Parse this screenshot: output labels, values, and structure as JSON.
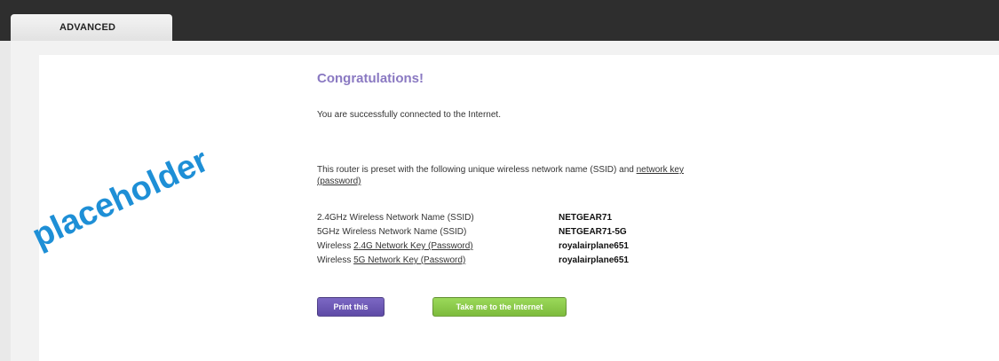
{
  "tabs": {
    "advanced_label": "ADVANCED"
  },
  "main": {
    "title": "Congratulations!",
    "success_message": "You are successfully connected to the Internet.",
    "preset_line1_before": "This router is preset with the following unique wireless network name (SSID) and ",
    "preset_link_part1": "network key",
    "preset_link_part2": "(password)",
    "network_info": [
      {
        "label_before": "2.4GHz Wireless Network Name (SSID)",
        "link": "",
        "label_after": "",
        "value": "NETGEAR71"
      },
      {
        "label_before": "5GHz Wireless Network Name (SSID)",
        "link": "",
        "label_after": "",
        "value": "NETGEAR71-5G"
      },
      {
        "label_before": "Wireless ",
        "link": "2.4G Network Key (Password)",
        "label_after": "",
        "value": "royalairplane651"
      },
      {
        "label_before": "Wireless ",
        "link": "5G Network Key (Password)",
        "label_after": "",
        "value": "royalairplane651"
      }
    ]
  },
  "buttons": {
    "print_label": "Print this",
    "internet_label": "Take me to the Internet"
  },
  "watermark": {
    "text": "placeholder"
  },
  "colors": {
    "title": "#8a79c2",
    "print_button": "#5e4aa6",
    "internet_button": "#7dbb3c",
    "watermark": "#1e8fd6",
    "top_bar": "#2e2e2e"
  }
}
